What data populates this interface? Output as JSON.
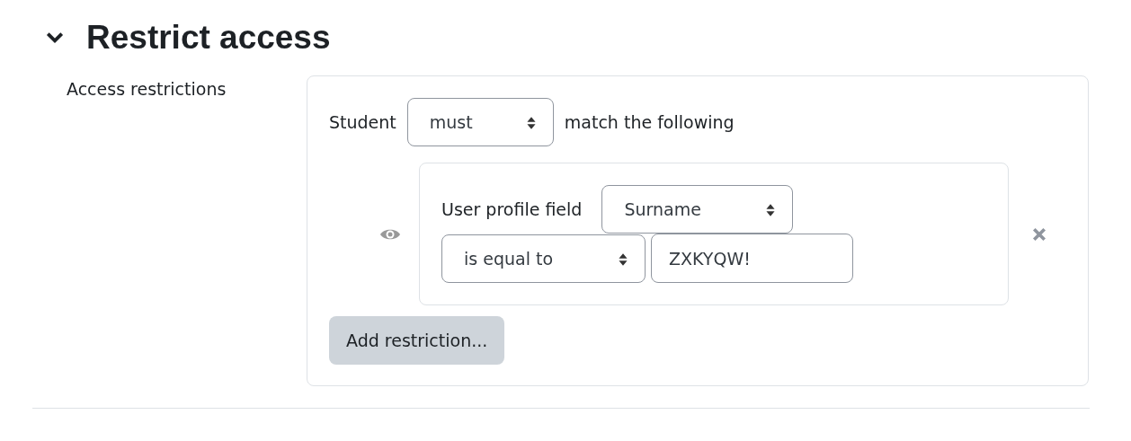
{
  "section": {
    "title": "Restrict access",
    "expanded": true
  },
  "field_label": "Access restrictions",
  "rule": {
    "subject": "Student",
    "mode": "must",
    "suffix": "match the following"
  },
  "conditions": [
    {
      "label": "User profile field",
      "field": "Surname",
      "operator": "is equal to",
      "value": "ZXKYQW!"
    }
  ],
  "add_button": "Add restriction..."
}
